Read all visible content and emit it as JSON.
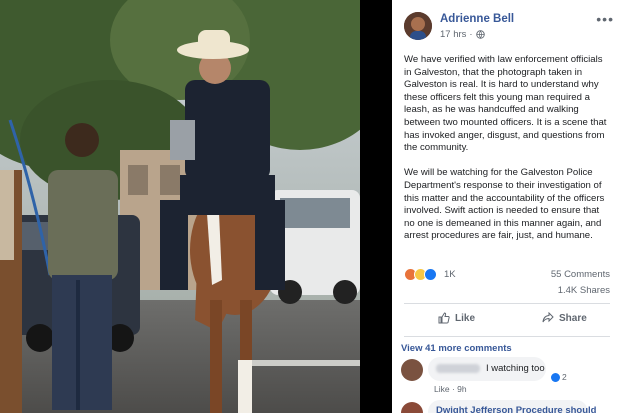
{
  "post": {
    "author": "Adrienne Bell",
    "time": "17 hrs",
    "paragraphs": [
      "We have verified with law enforcement officials in Galveston, that the photograph taken in Galveston is real. It is hard to understand why these officers felt this young man required a leash, as he was handcuffed and walking between two mounted officers. It is a scene that has invoked anger, disgust, and questions from the community.",
      "We will be watching for the Galveston Police Department's response to their investigation of this matter and the accountability of the officers involved. Swift action is needed to ensure that no one is demeaned in this manner again, and arrest procedures are fair, just, and humane."
    ],
    "reactions_count": "1K",
    "comments_count": "55 Comments",
    "shares_count": "1.4K Shares",
    "like_label": "Like",
    "share_label": "Share",
    "view_more_comments": "View 41 more comments",
    "reaction_icons": [
      "angry-reaction",
      "wow-reaction",
      "like-reaction"
    ]
  },
  "comments": [
    {
      "text": "I watching too",
      "like_count": "2",
      "meta": "Like · 9h"
    },
    {
      "text": "Dwight Jefferson Procedure should"
    }
  ],
  "colors": {
    "link_blue": "#385898",
    "secondary_text": "#606770",
    "facebook_blue": "#1877f2"
  }
}
